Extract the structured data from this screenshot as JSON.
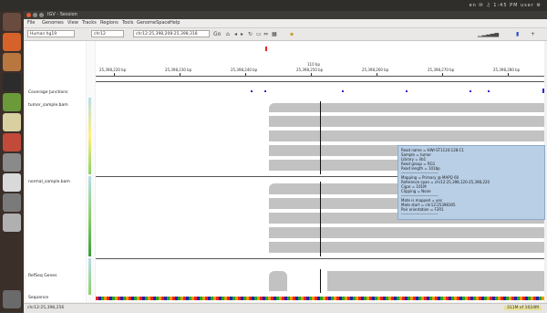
{
  "system": {
    "tray_text": "en  ✉  ♫  1:45 PM  user  ⚙"
  },
  "app": {
    "title": "IGV - Session",
    "menu": [
      "File",
      "Genomes",
      "View",
      "Tracks",
      "Regions",
      "Tools",
      "GenomeSpace",
      "Help"
    ]
  },
  "toolbar": {
    "genome": "Human hg19",
    "chromosome": "chr12",
    "locus": "chr12:25,398,208-25,398,318",
    "go_label": "Go"
  },
  "ruler": {
    "ticks": [
      "25,398,220 bp",
      "25,398,230 bp",
      "25,398,240 bp",
      "25,398,250 bp",
      "25,398,260 bp",
      "25,398,270 bp",
      "25,398,280 bp",
      "25,398,290 bp"
    ],
    "center_label": "110 bp"
  },
  "tracks": [
    {
      "name": "Coverage Junctions"
    },
    {
      "name": "tumor_sample.bam"
    },
    {
      "name": "normal_sample.bam"
    },
    {
      "name": "RefSeq Genes"
    }
  ],
  "popup": {
    "lines": [
      "Read name = HWI-ST1124:128:C1",
      "Sample = tumor",
      "Library = lib1",
      "Read group = RG1",
      "Read length = 101bp",
      "----------------------------",
      "Mapping = Primary @ MAPQ 60",
      "Reference span = chr12:25,398,120-25,398,220",
      "Cigar = 101M",
      "Clipping = None",
      "----------------------------",
      "Mate is mapped = yes",
      "Mate start = chr12:25398305",
      "Pair orientation = F2R1",
      "----------------------------",
      "Base = T @ QV 38"
    ]
  },
  "status": {
    "left": "chr12:25,398,256",
    "right": "311M of 1024M"
  },
  "sequence_label": "Sequence"
}
